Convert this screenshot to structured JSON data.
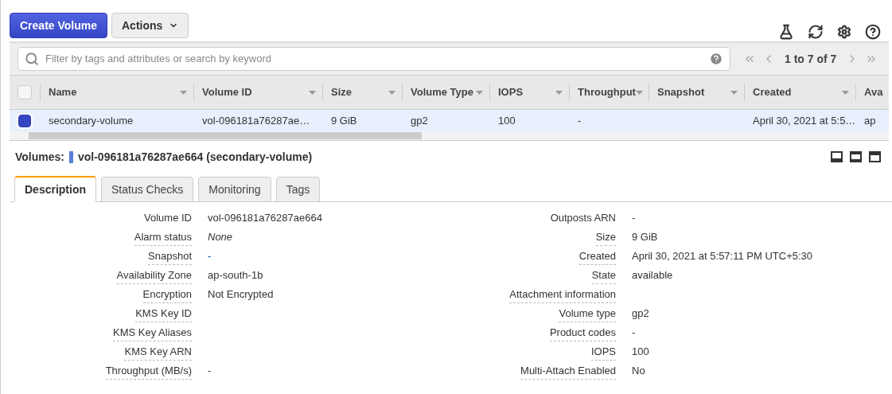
{
  "toolbar": {
    "create_button": "Create Volume",
    "actions_button": "Actions"
  },
  "filter": {
    "placeholder": "Filter by tags and attributes or search by keyword",
    "pagination": "1 to 7 of 7"
  },
  "table": {
    "select_all_checked": false,
    "columns": [
      "Name",
      "Volume ID",
      "Size",
      "Volume Type",
      "IOPS",
      "Throughput",
      "Snapshot",
      "Created",
      "Ava"
    ],
    "rows": [
      {
        "selected": true,
        "cells": [
          "secondary-volume",
          "vol-096181a76287ae…",
          "9 GiB",
          "gp2",
          "100",
          "-",
          "",
          "April 30, 2021 at 5:5…",
          "ap"
        ]
      }
    ]
  },
  "details": {
    "label": "Volumes:",
    "title": "vol-096181a76287ae664 (secondary-volume)",
    "tabs": [
      {
        "label": "Description",
        "selected": true
      },
      {
        "label": "Status Checks",
        "selected": false
      },
      {
        "label": "Monitoring",
        "selected": false
      },
      {
        "label": "Tags",
        "selected": false
      }
    ],
    "left": [
      {
        "label": "Volume ID",
        "value": "vol-096181a76287ae664",
        "kind": "text",
        "underlined": false
      },
      {
        "label": "Alarm status",
        "value": "None",
        "kind": "italic",
        "underlined": true
      },
      {
        "label": "Snapshot",
        "value": "-",
        "kind": "link",
        "underlined": true
      },
      {
        "label": "Availability Zone",
        "value": "ap-south-1b",
        "kind": "text",
        "underlined": true
      },
      {
        "label": "Encryption",
        "value": "Not Encrypted",
        "kind": "text",
        "underlined": true
      },
      {
        "label": "KMS Key ID",
        "underlined": true
      },
      {
        "label": "KMS Key Aliases",
        "underlined": true
      },
      {
        "label": "KMS Key ARN",
        "underlined": true
      },
      {
        "label": "Throughput (MB/s)",
        "value": "-",
        "kind": "text",
        "underlined": true
      }
    ],
    "right": [
      {
        "label": "Outposts ARN",
        "value": "-",
        "kind": "text",
        "underlined": false
      },
      {
        "label": "Size",
        "value": "9 GiB",
        "kind": "text",
        "underlined": true
      },
      {
        "label": "Created",
        "value": "April 30, 2021 at 5:57:11 PM UTC+5:30",
        "kind": "text",
        "underlined": true
      },
      {
        "label": "State",
        "value": "available",
        "kind": "text",
        "underlined": true
      },
      {
        "label": "Attachment information",
        "underlined": true
      },
      {
        "label": "Volume type",
        "value": "gp2",
        "kind": "text",
        "underlined": true
      },
      {
        "label": "Product codes",
        "value": "-",
        "kind": "text",
        "underlined": true
      },
      {
        "label": "IOPS",
        "value": "100",
        "kind": "text",
        "underlined": true
      },
      {
        "label": "Multi-Attach Enabled",
        "value": "No",
        "kind": "text",
        "underlined": true
      }
    ]
  }
}
